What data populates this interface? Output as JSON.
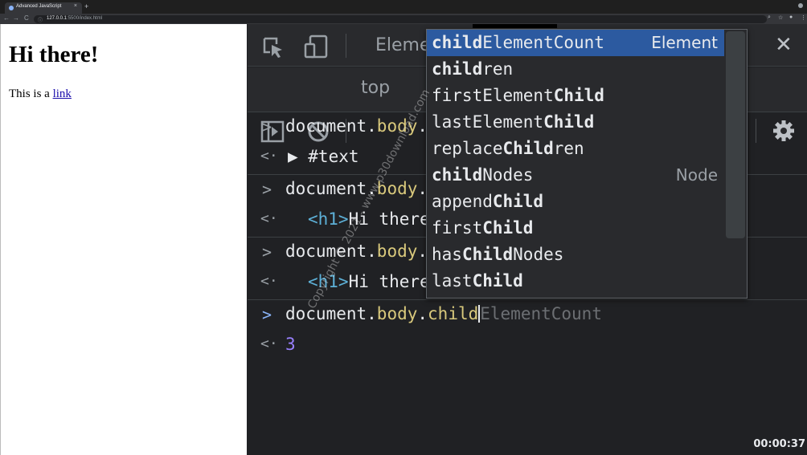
{
  "browser": {
    "tab_title": "Advanced JavaScript",
    "tab_close": "×",
    "new_tab": "+",
    "url_host": "127.0.0.1",
    "url_rest": ":5500/index.html",
    "nav_back": "←",
    "nav_forward": "→",
    "nav_reload": "C"
  },
  "page": {
    "heading": "Hi there!",
    "paragraph_prefix": "This is a ",
    "link_text": "link"
  },
  "devtools": {
    "elements_tab": "Eleme",
    "context": "top",
    "close": "✕"
  },
  "console": [
    {
      "type": "input",
      "prefix": "document.",
      "prop": "body",
      "suffix": "."
    },
    {
      "type": "output",
      "text": "▶ #text"
    },
    {
      "type": "input",
      "prefix": "document.",
      "prop": "body",
      "suffix": "."
    },
    {
      "type": "output",
      "open": "<h1>",
      "text": "Hi there"
    },
    {
      "type": "input",
      "prefix": "document.",
      "prop": "body",
      "suffix": "."
    },
    {
      "type": "output",
      "open": "<h1>",
      "text": "Hi there"
    },
    {
      "type": "input",
      "prefix": "document.",
      "prop": "body",
      "suffix": ".",
      "typed": "child",
      "ghost": "ElementCount"
    },
    {
      "type": "output",
      "value": "3"
    }
  ],
  "autocomplete": {
    "items": [
      {
        "pre": "",
        "bold": "child",
        "post": "ElementCount",
        "type": "Element",
        "selected": true
      },
      {
        "pre": "",
        "bold": "child",
        "post": "ren",
        "type": ""
      },
      {
        "pre": "firstElement",
        "bold": "Child",
        "post": "",
        "type": ""
      },
      {
        "pre": "lastElement",
        "bold": "Child",
        "post": "",
        "type": ""
      },
      {
        "pre": "replace",
        "bold": "Child",
        "post": "ren",
        "type": ""
      },
      {
        "pre": "",
        "bold": "child",
        "post": "Nodes",
        "type": "Node"
      },
      {
        "pre": "append",
        "bold": "Child",
        "post": "",
        "type": ""
      },
      {
        "pre": "first",
        "bold": "Child",
        "post": "",
        "type": ""
      },
      {
        "pre": "has",
        "bold": "Child",
        "post": "Nodes",
        "type": ""
      },
      {
        "pre": "last",
        "bold": "Child",
        "post": "",
        "type": ""
      }
    ]
  },
  "watermark": "Copyright © 2021 - www.p30download.com",
  "timestamp": "00:00:37"
}
